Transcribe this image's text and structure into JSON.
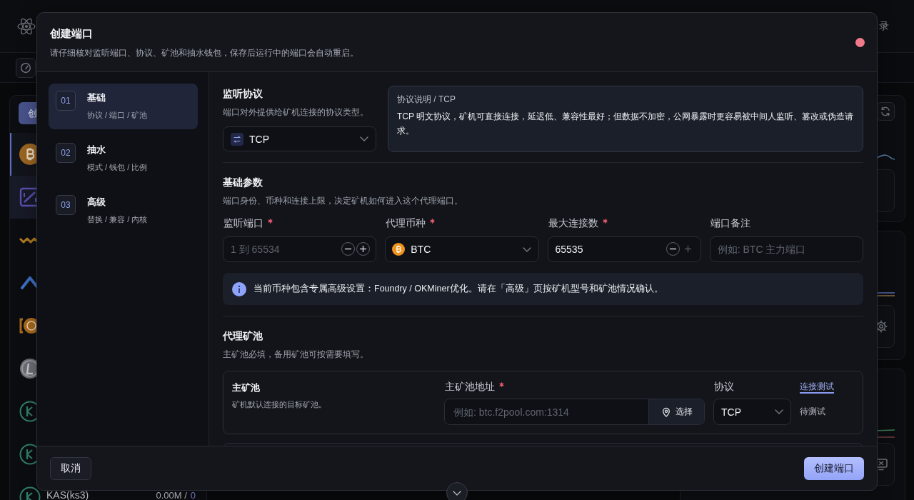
{
  "app": {
    "top_bar": {
      "right_text": "录"
    },
    "sidebar": {
      "create_button": "创",
      "coins": [
        {
          "kind": "bitcoin",
          "selected": true,
          "hovered": false
        },
        {
          "kind": "chart",
          "selected": false,
          "hovered": true
        },
        {
          "kind": "zigzag",
          "selected": false,
          "hovered": false
        },
        {
          "kind": "caret",
          "selected": false,
          "hovered": false
        },
        {
          "kind": "bracket",
          "selected": false,
          "hovered": false
        },
        {
          "kind": "silver",
          "selected": false,
          "hovered": false
        },
        {
          "kind": "kaspa",
          "selected": false,
          "hovered": false
        },
        {
          "kind": "kaspa",
          "selected": false,
          "hovered": false
        },
        {
          "kind": "kaspa",
          "selected": false,
          "hovered": false,
          "name": "KAS(ks3)",
          "hashrate": "0.00M /",
          "count": "0"
        }
      ]
    }
  },
  "dialog": {
    "title": "创建端口",
    "subtitle": "请仔细核对监听端口、协议、矿池和抽水钱包，保存后运行中的端口会自动重启。",
    "steps": [
      {
        "number": "01",
        "title": "基础",
        "subtitle": "协议 / 端口 / 矿池",
        "selected": true
      },
      {
        "number": "02",
        "title": "抽水",
        "subtitle": "模式 / 钱包 / 比例",
        "selected": false
      },
      {
        "number": "03",
        "title": "高级",
        "subtitle": "替换 / 兼容 / 内核",
        "selected": false
      }
    ],
    "protocol": {
      "title": "监听协议",
      "subtitle": "端口对外提供给矿机连接的协议类型。",
      "value": "TCP",
      "info_title": "协议说明 / TCP",
      "info_text": "TCP 明文协议，矿机可直接连接，延迟低、兼容性最好；但数据不加密，公网暴露时更容易被中间人监听、篡改或伪造请求。"
    },
    "basic": {
      "title": "基础参数",
      "subtitle": "端口身份、币种和连接上限，决定矿机如何进入这个代理端口。",
      "fields": [
        {
          "kind": "stepper",
          "label": "监听端口",
          "required": true,
          "placeholder": "1 到 65534",
          "minus_disabled": false,
          "plus_disabled": false
        },
        {
          "kind": "coin",
          "label": "代理币种",
          "required": true,
          "value": "BTC"
        },
        {
          "kind": "stepper",
          "label": "最大连接数",
          "required": true,
          "value": "65535",
          "minus_disabled": false,
          "plus_disabled": true
        },
        {
          "kind": "text",
          "label": "端口备注",
          "required": false,
          "placeholder": "例如: BTC 主力端口"
        }
      ],
      "notice": "当前币种包含专属高级设置：Foundry / OKMiner优化。请在「高级」页按矿机型号和矿池情况确认。"
    },
    "pools": {
      "title": "代理矿池",
      "subtitle": "主矿池必填，备用矿池可按需要填写。",
      "cards": [
        {
          "kind": "primary",
          "title": "主矿池",
          "subtitle": "矿机默认连接的目标矿池。",
          "address_label": "主矿池地址",
          "address_required": true,
          "address_placeholder": "例如: btc.f2pool.com:1314",
          "pick_button": "选择",
          "protocol_label": "协议",
          "protocol_value": "TCP",
          "test_link": "连接测试",
          "test_status": "待测试"
        },
        {
          "kind": "backup"
        }
      ]
    },
    "buttons": {
      "cancel": "取消",
      "submit": "创建端口"
    }
  }
}
